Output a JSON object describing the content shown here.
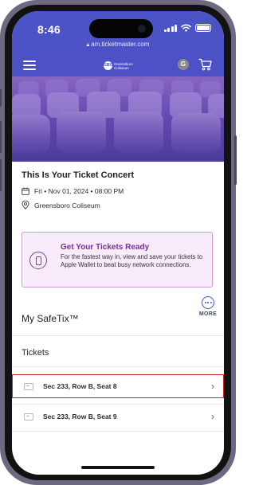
{
  "status_bar": {
    "time": "8:46"
  },
  "browser": {
    "url": "am.ticketmaster.com"
  },
  "header": {
    "venue_logo_text": "Greensboro Coliseum",
    "venue_logo_badge": "GBO",
    "avatar_initial": "G"
  },
  "event": {
    "title": "This Is Your Ticket Concert",
    "date": "Fri • Nov 01, 2024 • 08:00 PM",
    "venue": "Greensboro Coliseum"
  },
  "ready_card": {
    "title": "Get Your Tickets Ready",
    "body": "For the fastest way in, view and save your tickets to Apple Wallet to beat busy network connections."
  },
  "safetix": {
    "title": "My SafeTix™",
    "more_label": "MORE"
  },
  "tickets": {
    "title": "Tickets",
    "items": [
      {
        "label": "Sec 233, Row B, Seat 8",
        "selected": true
      },
      {
        "label": "Sec 233, Row B, Seat 9",
        "selected": false
      }
    ]
  },
  "colors": {
    "header_blue": "#4a55c7",
    "accent_purple": "#7b2f95",
    "selection_red": "#d12424"
  },
  "icons": [
    "menu-icon",
    "cart-icon",
    "calendar-icon",
    "location-pin-icon",
    "phone-wallet-icon",
    "more-icon",
    "ticket-icon",
    "chevron-right-icon"
  ]
}
